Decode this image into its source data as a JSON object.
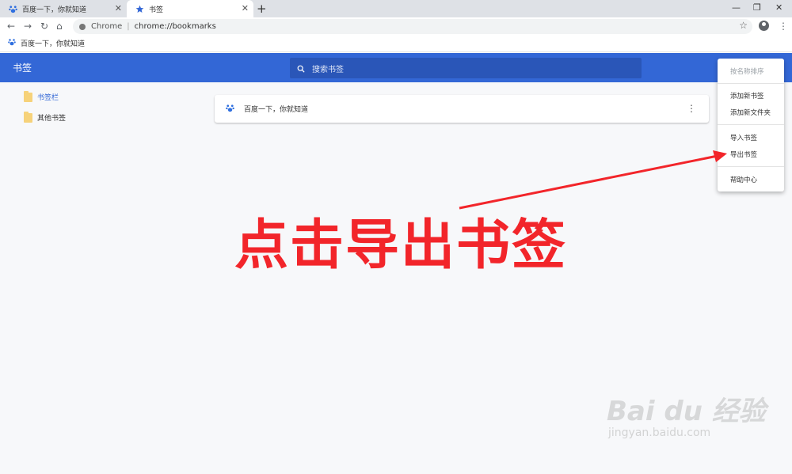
{
  "tabs": [
    {
      "title": "百度一下，你就知道",
      "icon": "baidu-paw-icon",
      "active": false
    },
    {
      "title": "书签",
      "icon": "star-icon",
      "active": true
    }
  ],
  "window_controls": [
    "minimize-icon",
    "restore-icon",
    "close-icon"
  ],
  "toolbar": {
    "chip_label": "Chrome",
    "separator": "|",
    "url": "chrome://bookmarks"
  },
  "bookmarks_bar": {
    "items": [
      {
        "label": "百度一下，你就知道",
        "icon": "baidu-paw-icon"
      }
    ]
  },
  "header": {
    "title": "书签",
    "search_placeholder": "搜索书签"
  },
  "sidebar": {
    "items": [
      {
        "label": "书签栏",
        "selected": true
      },
      {
        "label": "其他书签",
        "selected": false
      }
    ]
  },
  "main": {
    "bookmarks": [
      {
        "title": "百度一下，你就知道",
        "icon": "baidu-paw-icon"
      }
    ]
  },
  "menu": {
    "items": [
      {
        "label": "按名称排序",
        "disabled": true
      },
      {
        "label": "添加新书签",
        "disabled": false
      },
      {
        "label": "添加新文件夹",
        "disabled": false
      },
      {
        "label": "导入书签",
        "disabled": false
      },
      {
        "label": "导出书签",
        "disabled": false
      },
      {
        "label": "帮助中心",
        "disabled": false
      }
    ]
  },
  "annotation": {
    "text": "点击导出书签",
    "color": "#f2252a"
  },
  "watermark": {
    "logo_text": "Bai du 经验",
    "url": "jingyan.baidu.com"
  },
  "colors": {
    "accent": "#3367d6",
    "header_search": "#2a56b8",
    "folder": "#f6d27a"
  }
}
